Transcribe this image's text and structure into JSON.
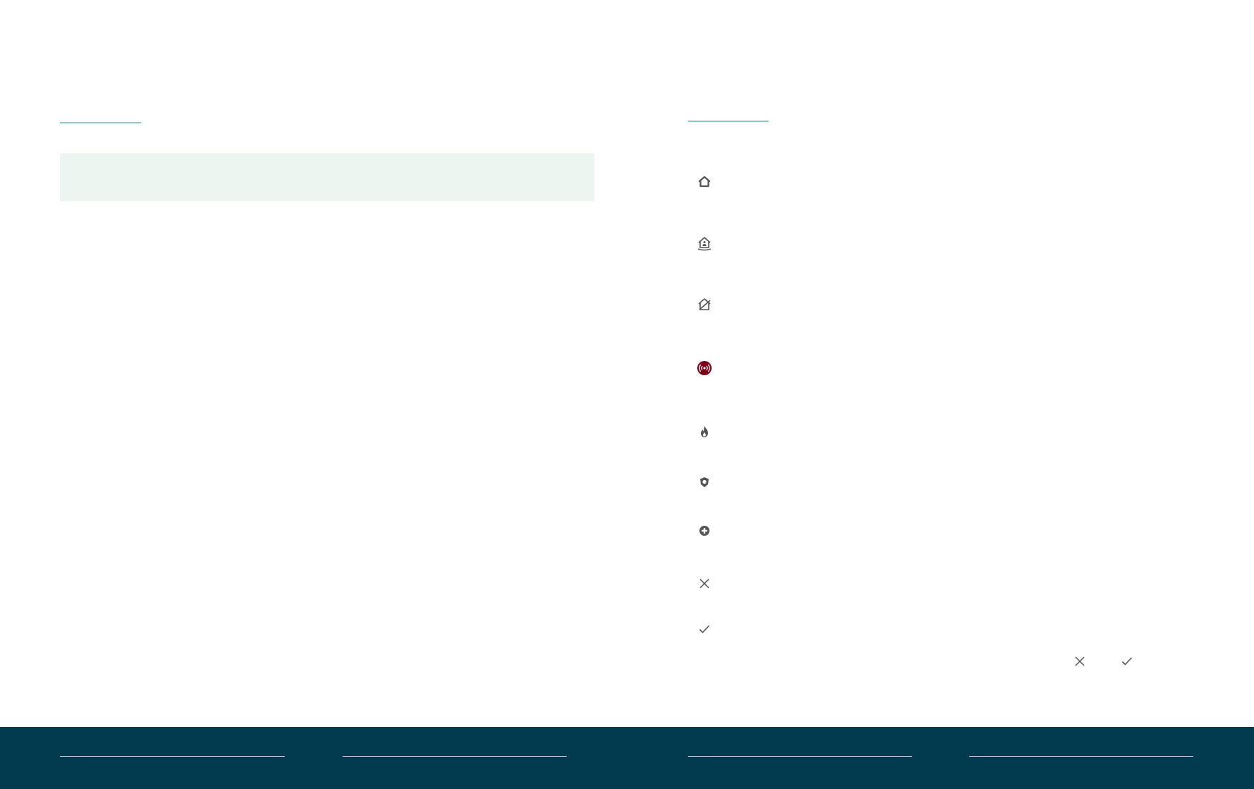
{
  "colors": {
    "accent": "#8fc9bd",
    "note_background": "#edf5f1",
    "icon": "#555555",
    "alarm": "#7a0018",
    "footer": "#023b50"
  },
  "legend_icons": [
    "home-outline-icon",
    "home-person-icon",
    "home-off-icon",
    "alarm-broadcast-icon",
    "fire-icon",
    "panic-shield-icon",
    "medical-plus-icon",
    "close-icon",
    "check-icon"
  ]
}
